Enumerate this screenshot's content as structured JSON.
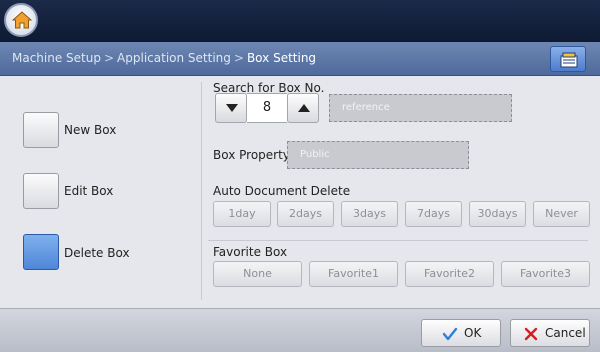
{
  "breadcrumb": {
    "items": [
      "Machine Setup",
      "Application Setting",
      "Box Setting"
    ],
    "separator": ">"
  },
  "left_menu": {
    "items": [
      {
        "label": "New Box",
        "selected": false
      },
      {
        "label": "Edit Box",
        "selected": false
      },
      {
        "label": "Delete Box",
        "selected": true
      }
    ]
  },
  "search": {
    "label": "Search for Box No.",
    "value": "8",
    "name_field": "reference"
  },
  "box_property": {
    "label": "Box Property:",
    "value": "Public"
  },
  "auto_delete": {
    "label": "Auto Document Delete",
    "options": [
      "1day",
      "2days",
      "3days",
      "7days",
      "30days",
      "Never"
    ]
  },
  "favorite": {
    "label": "Favorite Box",
    "options": [
      "None",
      "Favorite1",
      "Favorite2",
      "Favorite3"
    ]
  },
  "footer": {
    "ok_label": "OK",
    "cancel_label": "Cancel"
  },
  "colors": {
    "accent_blue": "#4f86d8",
    "ok_check": "#2f7fd8",
    "cancel_x": "#d02020"
  }
}
